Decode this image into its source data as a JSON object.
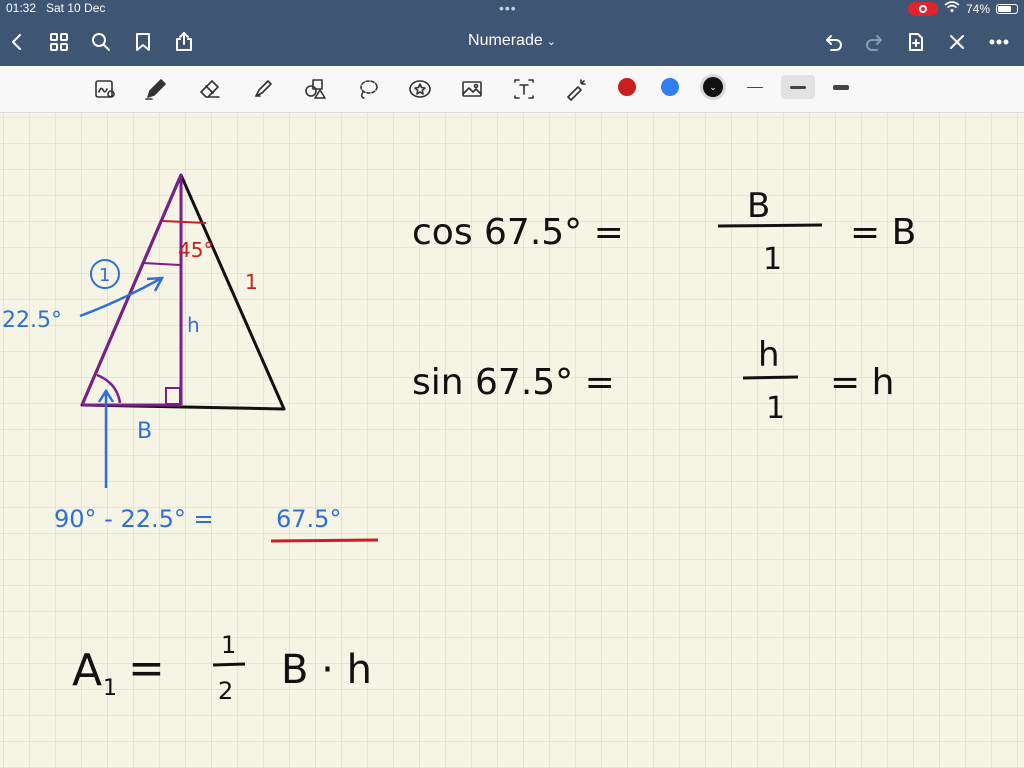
{
  "status": {
    "time": "01:32",
    "date": "Sat 10 Dec",
    "battery": "74%",
    "battery_level": 0.74
  },
  "nav": {
    "title": "Numerade",
    "icons": [
      "back-icon",
      "grid-icon",
      "search-icon",
      "bookmark-icon",
      "share-icon",
      "undo-icon",
      "redo-icon",
      "add-page-icon",
      "close-icon",
      "more-icon"
    ]
  },
  "toolbar": {
    "tools": [
      "read-mode-icon",
      "pen-icon",
      "eraser-icon",
      "highlighter-icon",
      "shapes-icon",
      "lasso-icon",
      "sticker-icon",
      "image-icon",
      "text-icon",
      "laser-pointer-icon"
    ],
    "colors": [
      "#cc1e1e",
      "#2f7ff0",
      "#111111"
    ],
    "selected_color": "#111111"
  },
  "note": {
    "apex_angle": "45°",
    "side_label": "1",
    "circle_label": "1",
    "angle_label": "22.5°",
    "height_label": "h",
    "base_label": "B",
    "eq_left": "90° - 22.5° = ",
    "eq_result": "67.5°",
    "cos_lhs": "cos 67.5° =",
    "cos_num": "B",
    "cos_den": "1",
    "cos_rhs": "= B",
    "sin_lhs": "sin 67.5° =",
    "sin_num": "h",
    "sin_den": "1",
    "sin_rhs": "= h",
    "area_lhs": "A",
    "area_sub": "1",
    "area_eq": "=",
    "area_num": "1",
    "area_den": "2",
    "area_rhs": "B · h"
  }
}
